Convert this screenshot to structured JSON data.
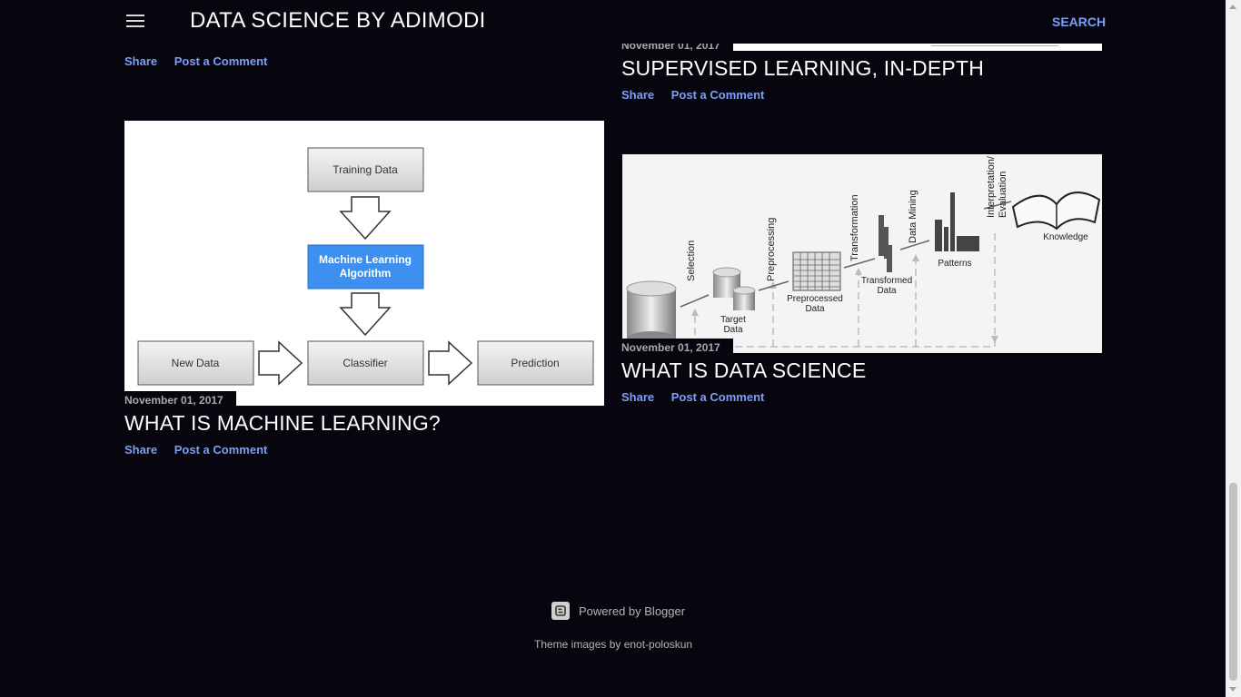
{
  "header": {
    "title": "DATA SCIENCE BY ADIMODI",
    "search_label": "SEARCH"
  },
  "posts": [
    {
      "share": "Share",
      "comment": "Post a Comment"
    },
    {
      "date": "November 01, 2017",
      "title": "SUPERVISED LEARNING, IN-DEPTH",
      "share": "Share",
      "comment": "Post a Comment"
    },
    {
      "date": "November 01, 2017",
      "title": "WHAT IS MACHINE LEARNING?",
      "share": "Share",
      "comment": "Post a Comment",
      "diagram": {
        "training": "Training Data",
        "algo_line1": "Machine Learning",
        "algo_line2": "Algorithm",
        "newdata": "New Data",
        "classifier": "Classifier",
        "prediction": "Prediction"
      }
    },
    {
      "date": "November 01, 2017",
      "title": "WHAT IS DATA SCIENCE",
      "share": "Share",
      "comment": "Post a Comment",
      "diagram": {
        "selection": "Selection",
        "preprocessing": "Preprocessing",
        "transformation": "Transformation",
        "datamining": "Data Mining",
        "interp1": "Interpretation/",
        "interp2": "Evaluation",
        "target1": "Target",
        "target2": "Data",
        "pre1": "Preprocessed",
        "pre2": "Data",
        "trans1": "Transformed",
        "trans2": "Data",
        "patterns": "Patterns",
        "knowledge": "Knowledge"
      }
    }
  ],
  "footer": {
    "powered": "Powered by Blogger",
    "theme": "Theme images by enot-poloskun"
  },
  "colors": {
    "background": "#07060f",
    "link": "#7c9ef5",
    "algo_box": "#3d8ff0"
  }
}
